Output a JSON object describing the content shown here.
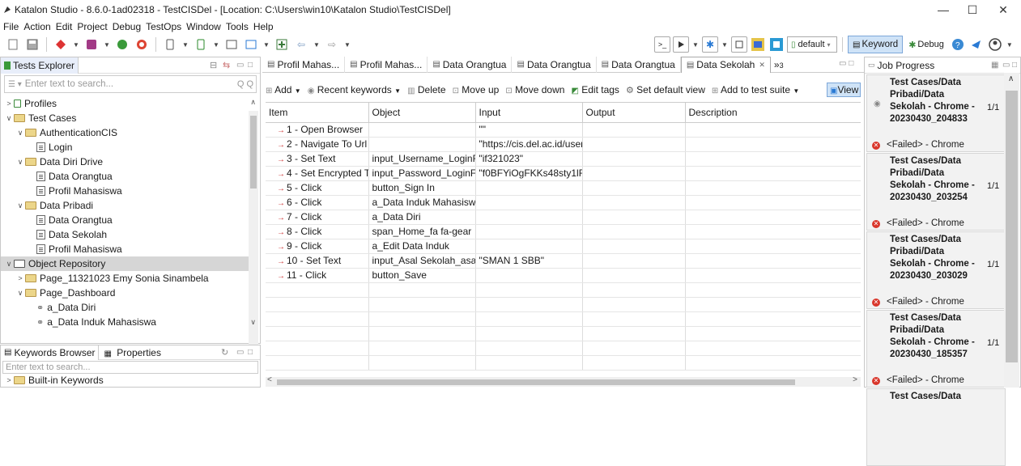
{
  "window": {
    "title": "Katalon Studio - 8.6.0-1ad02318 - TestCISDel - [Location: C:\\Users\\win10\\Katalon Studio\\TestCISDel]",
    "minimize": "—",
    "maximize": "☐",
    "close": "✕"
  },
  "menu": [
    "File",
    "Action",
    "Edit",
    "Project",
    "Debug",
    "TestOps",
    "Window",
    "Tools",
    "Help"
  ],
  "toolbar": {
    "profile": "default",
    "keyword_label": "Keyword",
    "debug_label": "Debug"
  },
  "tests_explorer": {
    "title": "Tests Explorer",
    "search_placeholder": "Enter text to search...",
    "tree": [
      {
        "label": "Profiles",
        "kind": "profile",
        "level": 0,
        "arrow": ">"
      },
      {
        "label": "Test Cases",
        "kind": "folder",
        "level": 0,
        "arrow": "v"
      },
      {
        "label": "AuthenticationCIS",
        "kind": "folder",
        "level": 1,
        "arrow": "v"
      },
      {
        "label": "Login",
        "kind": "doc",
        "level": 2,
        "arrow": ""
      },
      {
        "label": "Data Diri Drive",
        "kind": "folder",
        "level": 1,
        "arrow": "v"
      },
      {
        "label": "Data Orangtua",
        "kind": "doc",
        "level": 2,
        "arrow": ""
      },
      {
        "label": "Profil Mahasiswa",
        "kind": "doc",
        "level": 2,
        "arrow": ""
      },
      {
        "label": "Data Pribadi",
        "kind": "folder",
        "level": 1,
        "arrow": "v"
      },
      {
        "label": "Data Orangtua",
        "kind": "doc",
        "level": 2,
        "arrow": ""
      },
      {
        "label": "Data Sekolah",
        "kind": "doc",
        "level": 2,
        "arrow": ""
      },
      {
        "label": "Profil Mahasiswa",
        "kind": "doc",
        "level": 2,
        "arrow": ""
      },
      {
        "label": "Object Repository",
        "kind": "repo",
        "level": 0,
        "arrow": "v",
        "selected": true
      },
      {
        "label": "Page_11321023 Emy Sonia Sinambela",
        "kind": "folder",
        "level": 1,
        "arrow": ">"
      },
      {
        "label": "Page_Dashboard",
        "kind": "folder",
        "level": 1,
        "arrow": "v"
      },
      {
        "label": "a_Data Diri",
        "kind": "link",
        "level": 2,
        "arrow": ""
      },
      {
        "label": "a_Data Induk Mahasiswa",
        "kind": "link",
        "level": 2,
        "arrow": ""
      }
    ]
  },
  "keywords_panel": {
    "tab1": "Keywords Browser",
    "tab2": "Properties",
    "search_placeholder": "Enter text to search...",
    "first_item": "Built-in Keywords"
  },
  "editor_tabs": [
    {
      "label": "Profil Mahas...",
      "active": false
    },
    {
      "label": "Profil Mahas...",
      "active": false
    },
    {
      "label": "Data Orangtua",
      "active": false
    },
    {
      "label": "Data Orangtua",
      "active": false
    },
    {
      "label": "Data Orangtua",
      "active": false
    },
    {
      "label": "Data Sekolah",
      "active": true
    }
  ],
  "tab_overflow": "»",
  "tab_overflow_count": "3",
  "actions": {
    "add": "Add",
    "recent": "Recent keywords",
    "delete": "Delete",
    "move_up": "Move up",
    "move_down": "Move down",
    "edit_tags": "Edit tags",
    "set_default_view": "Set default view",
    "add_to_suite": "Add to test suite",
    "view": "View"
  },
  "grid": {
    "columns": [
      "Item",
      "Object",
      "Input",
      "Output",
      "Description"
    ],
    "rows": [
      {
        "item": "1 - Open Browser",
        "object": "",
        "input": "\"\"",
        "output": "",
        "description": ""
      },
      {
        "item": "2 - Navigate To Url",
        "object": "",
        "input": "\"https://cis.del.ac.id/user",
        "output": "",
        "description": ""
      },
      {
        "item": "3 - Set Text",
        "object": "input_Username_LoginFo",
        "input": "\"if321023\"",
        "output": "",
        "description": ""
      },
      {
        "item": "4 - Set Encrypted Text",
        "object": "input_Password_LoginFo",
        "input": "\"f0BFYiOgFKKs48sty1lFs",
        "output": "",
        "description": ""
      },
      {
        "item": "5 - Click",
        "object": "button_Sign In",
        "input": "",
        "output": "",
        "description": ""
      },
      {
        "item": "6 - Click",
        "object": "a_Data Induk Mahasiswa",
        "input": "",
        "output": "",
        "description": ""
      },
      {
        "item": "7 - Click",
        "object": "a_Data Diri",
        "input": "",
        "output": "",
        "description": ""
      },
      {
        "item": "8 - Click",
        "object": "span_Home_fa fa-gear",
        "input": "",
        "output": "",
        "description": ""
      },
      {
        "item": "9 - Click",
        "object": "a_Edit Data Induk",
        "input": "",
        "output": "",
        "description": ""
      },
      {
        "item": "10 - Set Text",
        "object": "input_Asal Sekolah_asal_",
        "input": "\"SMAN 1 SBB\"",
        "output": "",
        "description": ""
      },
      {
        "item": "11 - Click",
        "object": "button_Save",
        "input": "",
        "output": "",
        "description": ""
      }
    ]
  },
  "job_progress": {
    "title": "Job Progress",
    "jobs": [
      {
        "name": "Test Cases/Data Pribadi/Data Sekolah - Chrome - 20230430_204833",
        "count": "1/1",
        "status": "<Failed> - Chrome"
      },
      {
        "name": "Test Cases/Data Pribadi/Data Sekolah - Chrome - 20230430_203254",
        "count": "1/1",
        "status": "<Failed> - Chrome"
      },
      {
        "name": "Test Cases/Data Pribadi/Data Sekolah - Chrome - 20230430_203029",
        "count": "1/1",
        "status": "<Failed> - Chrome"
      },
      {
        "name": "Test Cases/Data Pribadi/Data Sekolah - Chrome - 20230430_185357",
        "count": "1/1",
        "status": "<Failed> - Chrome"
      },
      {
        "name": "Test Cases/Data",
        "count": "",
        "status": ""
      }
    ]
  }
}
